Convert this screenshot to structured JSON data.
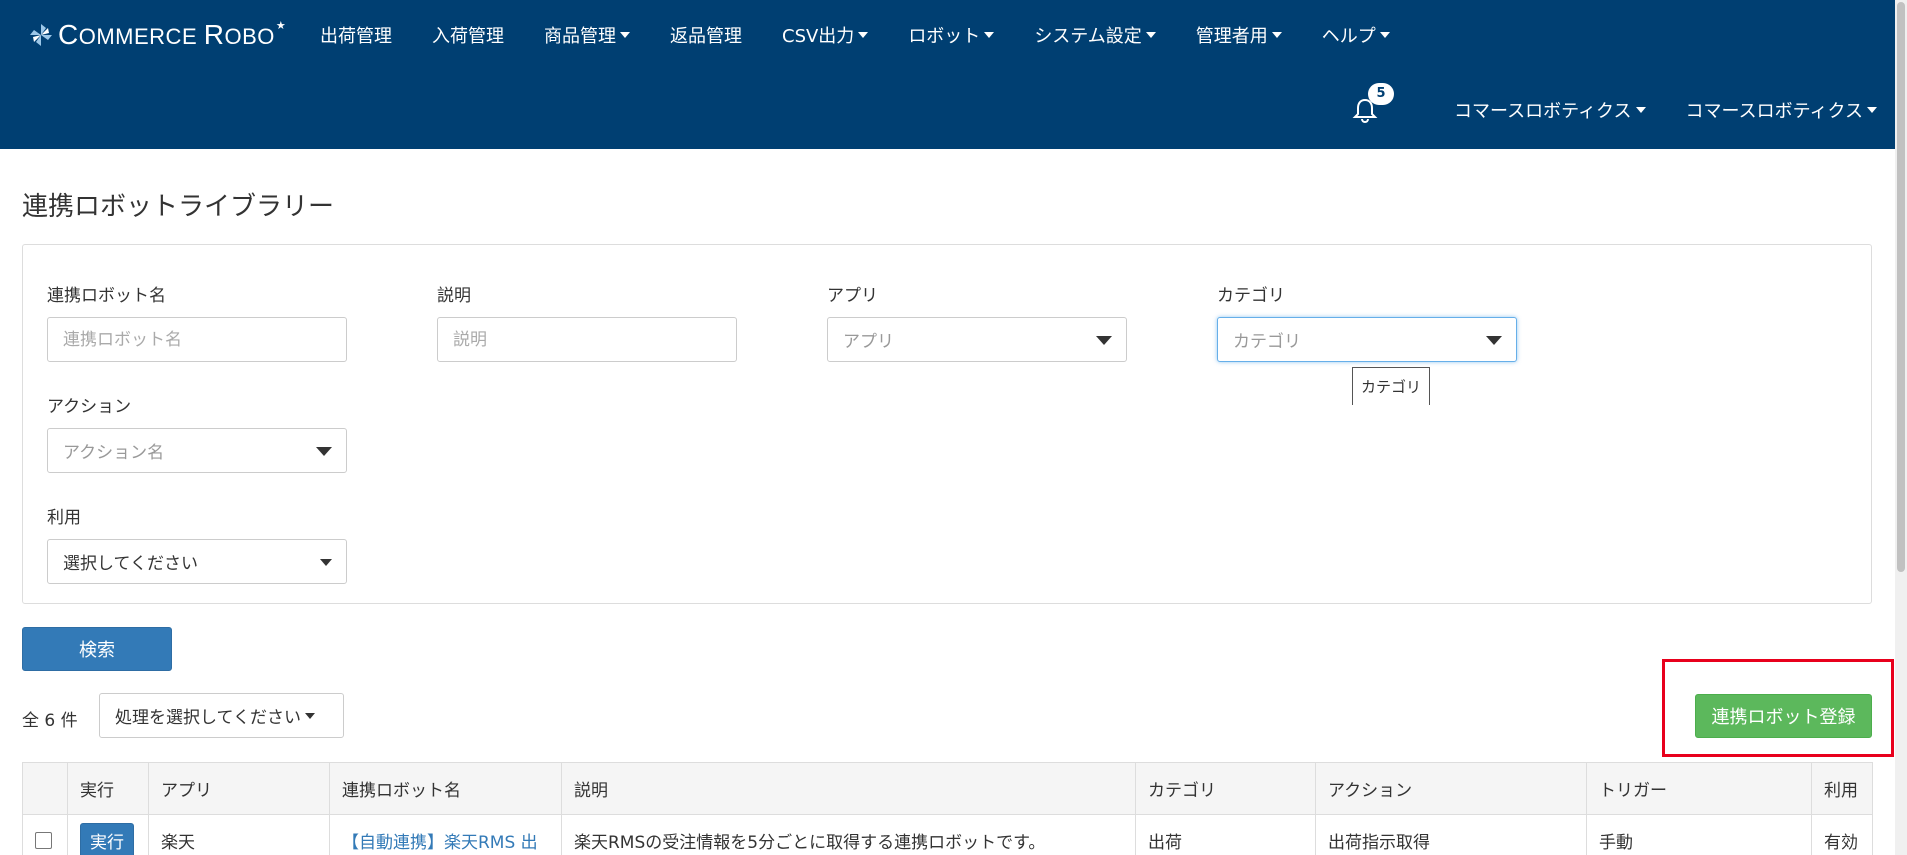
{
  "brand": {
    "logo_text": "Commerce Robo",
    "logo_icon": "pinwheel-logo-icon"
  },
  "nav": {
    "items": [
      {
        "label": "出荷管理",
        "dropdown": false
      },
      {
        "label": "入荷管理",
        "dropdown": false
      },
      {
        "label": "商品管理",
        "dropdown": true
      },
      {
        "label": "返品管理",
        "dropdown": false
      },
      {
        "label": "CSV出力",
        "dropdown": true
      },
      {
        "label": "ロボット",
        "dropdown": true
      },
      {
        "label": "システム設定",
        "dropdown": true
      },
      {
        "label": "管理者用",
        "dropdown": true
      },
      {
        "label": "ヘルプ",
        "dropdown": true
      }
    ],
    "notifications": {
      "icon": "bell-icon",
      "count": "5"
    },
    "user_menu_1": "コマースロボティクス",
    "user_menu_2": "コマースロボティクス"
  },
  "page": {
    "title": "連携ロボットライブラリー"
  },
  "filters": {
    "robot_name": {
      "label": "連携ロボット名",
      "placeholder": "連携ロボット名",
      "value": ""
    },
    "description": {
      "label": "説明",
      "placeholder": "説明",
      "value": ""
    },
    "app": {
      "label": "アプリ",
      "placeholder": "アプリ"
    },
    "category": {
      "label": "カテゴリ",
      "placeholder": "カテゴリ",
      "tooltip": "カテゴリ"
    },
    "action": {
      "label": "アクション",
      "placeholder": "アクション名"
    },
    "usage": {
      "label": "利用",
      "selected": "選択してください"
    }
  },
  "search_button": "検索",
  "results": {
    "count_text": "全 6 件",
    "bulk_action": "処理を選択してください",
    "register_button": "連携ロボット登録"
  },
  "table": {
    "headers": [
      "",
      "実行",
      "アプリ",
      "連携ロボット名",
      "説明",
      "カテゴリ",
      "アクション",
      "トリガー",
      "利用"
    ],
    "rows": [
      {
        "run_label": "実行",
        "app": "楽天",
        "name": "【自動連携】楽天RMS 出",
        "description": "楽天RMSの受注情報を5分ごとに取得する連携ロボットです。",
        "category": "出荷",
        "action": "出荷指示取得",
        "trigger": "手動",
        "usage": "有効"
      }
    ]
  },
  "colors": {
    "navbar": "#003f72",
    "primary": "#337ab7",
    "success": "#5cb85c",
    "highlight": "#e8001c"
  }
}
